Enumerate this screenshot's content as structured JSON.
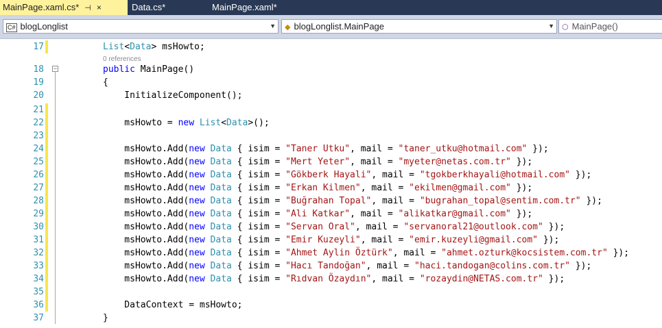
{
  "tabs": [
    {
      "label": "MainPage.xaml.cs*",
      "active": true,
      "pin": "⊣",
      "close": "×"
    },
    {
      "label": "Data.cs*",
      "active": false
    },
    {
      "label": "MainPage.xaml*",
      "active": false
    }
  ],
  "nav": {
    "project": {
      "icon": "C#",
      "label": "blogLonglist"
    },
    "class": {
      "icon": "◆",
      "label": "blogLonglist.MainPage"
    },
    "member": {
      "icon": "⬡",
      "label": "MainPage()"
    }
  },
  "editor": {
    "ref_hint": "0 references",
    "lines": [
      {
        "num": "17",
        "changed": true
      },
      {
        "num": "18",
        "changed": false
      },
      {
        "num": "19",
        "changed": false
      },
      {
        "num": "20",
        "changed": false
      },
      {
        "num": "21",
        "changed": true
      },
      {
        "num": "22",
        "changed": true
      },
      {
        "num": "23",
        "changed": true
      },
      {
        "num": "24",
        "changed": true
      },
      {
        "num": "25",
        "changed": true
      },
      {
        "num": "26",
        "changed": true
      },
      {
        "num": "27",
        "changed": true
      },
      {
        "num": "28",
        "changed": true
      },
      {
        "num": "29",
        "changed": true
      },
      {
        "num": "30",
        "changed": true
      },
      {
        "num": "31",
        "changed": true
      },
      {
        "num": "32",
        "changed": true
      },
      {
        "num": "33",
        "changed": true
      },
      {
        "num": "34",
        "changed": true
      },
      {
        "num": "35",
        "changed": true
      },
      {
        "num": "36",
        "changed": true
      },
      {
        "num": "37",
        "changed": false
      }
    ],
    "code": {
      "l17": {
        "a": "List",
        "b": "<",
        "c": "Data",
        "d": "> msHowto;"
      },
      "l18": {
        "a": "public",
        "b": " MainPage()"
      },
      "l19": "{",
      "l20": "    InitializeComponent();",
      "l22": {
        "a": "    msHowto = ",
        "b": "new",
        "c": " ",
        "d": "List",
        "e": "<",
        "f": "Data",
        "g": ">();"
      },
      "adds": [
        {
          "pre": "    msHowto.Add(",
          "kw": "new",
          "ty": "Data",
          "mid1": " { isim = ",
          "name": "\"Taner Utku\"",
          "mid2": ", mail = ",
          "mail": "\"taner_utku@hotmail.com\"",
          "end": " });"
        },
        {
          "pre": "    msHowto.Add(",
          "kw": "new",
          "ty": "Data",
          "mid1": " { isim = ",
          "name": "\"Mert Yeter\"",
          "mid2": ", mail = ",
          "mail": "\"myeter@netas.com.tr\"",
          "end": " });"
        },
        {
          "pre": "    msHowto.Add(",
          "kw": "new",
          "ty": "Data",
          "mid1": " { isim = ",
          "name": "\"Gökberk Hayali\"",
          "mid2": ", mail = ",
          "mail": "\"tgokberkhayali@hotmail.com\"",
          "end": " });"
        },
        {
          "pre": "    msHowto.Add(",
          "kw": "new",
          "ty": "Data",
          "mid1": " { isim = ",
          "name": "\"Erkan Kilmen\"",
          "mid2": ", mail = ",
          "mail": "\"ekilmen@gmail.com\"",
          "end": " });"
        },
        {
          "pre": "    msHowto.Add(",
          "kw": "new",
          "ty": "Data",
          "mid1": " { isim = ",
          "name": "\"Buğrahan Topal\"",
          "mid2": ", mail = ",
          "mail": "\"bugrahan_topal@sentim.com.tr\"",
          "end": " });"
        },
        {
          "pre": "    msHowto.Add(",
          "kw": "new",
          "ty": "Data",
          "mid1": " { isim = ",
          "name": "\"Ali Katkar\"",
          "mid2": ", mail = ",
          "mail": "\"alikatkar@gmail.com\"",
          "end": " });"
        },
        {
          "pre": "    msHowto.Add(",
          "kw": "new",
          "ty": "Data",
          "mid1": " { isim = ",
          "name": "\"Servan Oral\"",
          "mid2": ", mail = ",
          "mail": "\"servanoral21@outlook.com\"",
          "end": " });"
        },
        {
          "pre": "    msHowto.Add(",
          "kw": "new",
          "ty": "Data",
          "mid1": " { isim = ",
          "name": "\"Emir Kuzeyli\"",
          "mid2": ", mail = ",
          "mail": "\"emir.kuzeyli@gmail.com\"",
          "end": " });"
        },
        {
          "pre": "    msHowto.Add(",
          "kw": "new",
          "ty": "Data",
          "mid1": " { isim = ",
          "name": "\"Ahmet Aylin Öztürk\"",
          "mid2": ", mail = ",
          "mail": "\"ahmet.ozturk@kocsistem.com.tr\"",
          "end": " });"
        },
        {
          "pre": "    msHowto.Add(",
          "kw": "new",
          "ty": "Data",
          "mid1": " { isim = ",
          "name": "\"Hacı Tandoğan\"",
          "mid2": ", mail = ",
          "mail": "\"haci.tandogan@colins.com.tr\"",
          "end": " });"
        },
        {
          "pre": "    msHowto.Add(",
          "kw": "new",
          "ty": "Data",
          "mid1": " { isim = ",
          "name": "\"Rıdvan Özaydın\"",
          "mid2": ", mail = ",
          "mail": "\"rozaydin@NETAS.com.tr\"",
          "end": " });"
        }
      ],
      "l36": "    DataContext = msHowto;",
      "l37": "}"
    }
  },
  "colors": {
    "tabbar": "#293955",
    "active_tab": "#fff29d",
    "keyword": "#0000ff",
    "type": "#2b91af",
    "string": "#a31515",
    "line_number": "#2b91af",
    "changed_marker": "#f7e64b"
  }
}
